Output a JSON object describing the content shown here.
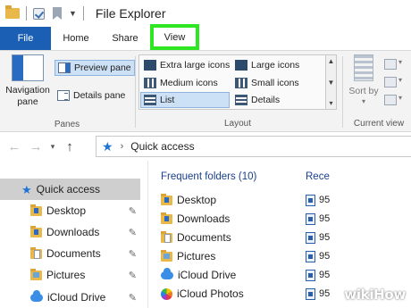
{
  "titlebar": {
    "title": "File Explorer"
  },
  "tabs": [
    {
      "label": "File"
    },
    {
      "label": "Home"
    },
    {
      "label": "Share"
    },
    {
      "label": "View"
    }
  ],
  "ribbon": {
    "panes": {
      "navigation_pane_label": "Navigation pane",
      "preview_pane_label": "Preview pane",
      "details_pane_label": "Details pane",
      "group_label": "Panes"
    },
    "layout": {
      "extra_large_icons": "Extra large icons",
      "large_icons": "Large icons",
      "medium_icons": "Medium icons",
      "small_icons": "Small icons",
      "list": "List",
      "details": "Details",
      "group_label": "Layout"
    },
    "current_view": {
      "sort_by_label": "Sort by",
      "group_label": "Current view"
    }
  },
  "address_bar": {
    "path": "Quick access"
  },
  "nav_tree": [
    {
      "label": "Quick access",
      "icon": "star-icon"
    },
    {
      "label": "Desktop",
      "icon": "folder-icon"
    },
    {
      "label": "Downloads",
      "icon": "downloads-folder-icon"
    },
    {
      "label": "Documents",
      "icon": "documents-folder-icon"
    },
    {
      "label": "Pictures",
      "icon": "pictures-folder-icon"
    },
    {
      "label": "iCloud Drive",
      "icon": "icloud-icon"
    }
  ],
  "content": {
    "frequent_header": "Frequent folders (10)",
    "recent_header": "Rece",
    "frequent": [
      {
        "label": "Desktop",
        "icon": "folder-icon"
      },
      {
        "label": "Downloads",
        "icon": "downloads-folder-icon"
      },
      {
        "label": "Documents",
        "icon": "documents-folder-icon"
      },
      {
        "label": "Pictures",
        "icon": "pictures-folder-icon"
      },
      {
        "label": "iCloud Drive",
        "icon": "icloud-icon"
      },
      {
        "label": "iCloud Photos",
        "icon": "icloud-photos-icon"
      }
    ],
    "recent": [
      "95",
      "95",
      "95",
      "95",
      "95",
      "95"
    ]
  },
  "watermark": {
    "text": "wikiHow"
  }
}
